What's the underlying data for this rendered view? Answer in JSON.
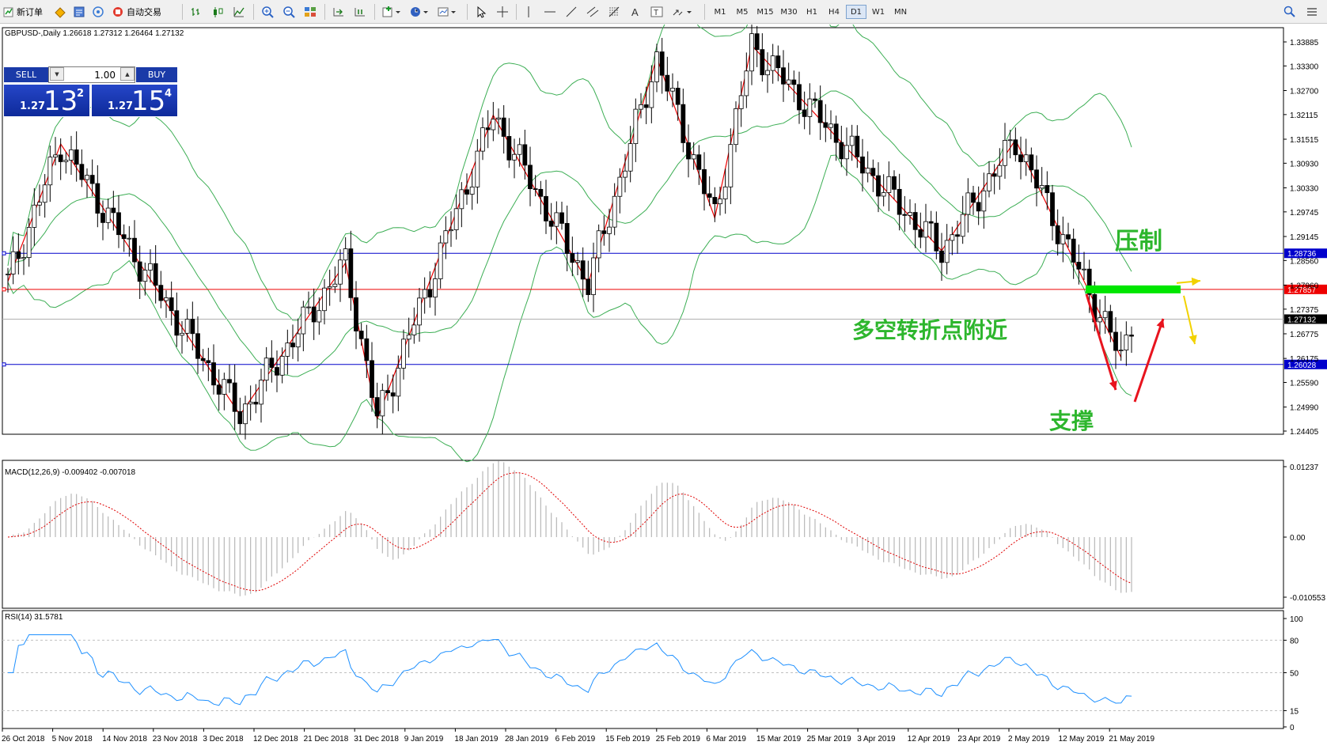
{
  "toolbar": {
    "new_order_label": "新订单",
    "autotrading_label": "自动交易",
    "timeframes": [
      "M1",
      "M5",
      "M15",
      "M30",
      "H1",
      "H4",
      "D1",
      "W1",
      "MN"
    ],
    "active_timeframe": "D1"
  },
  "trade_panel": {
    "sell_label": "SELL",
    "buy_label": "BUY",
    "lot": "1.00",
    "sell_prefix": "1.27",
    "sell_big": "13",
    "sell_sup": "2",
    "buy_prefix": "1.27",
    "buy_big": "15",
    "buy_sup": "4"
  },
  "chart": {
    "header": "GBPUSD-,Daily  1.26618 1.27312 1.26464 1.27132",
    "price_axis": [
      "1.33885",
      "1.33300",
      "1.32700",
      "1.32115",
      "1.31515",
      "1.30930",
      "1.30330",
      "1.29745",
      "1.29145",
      "1.28560",
      "1.27960",
      "1.27375",
      "1.26775",
      "1.26175",
      "1.25590",
      "1.24990",
      "1.24405"
    ],
    "price_axis_min": 1.24405,
    "price_axis_max": 1.33885,
    "date_axis": [
      "26 Oct 2018",
      "5 Nov 2018",
      "14 Nov 2018",
      "23 Nov 2018",
      "3 Dec 2018",
      "12 Dec 2018",
      "21 Dec 2018",
      "31 Dec 2018",
      "9 Jan 2019",
      "18 Jan 2019",
      "28 Jan 2019",
      "6 Feb 2019",
      "15 Feb 2019",
      "25 Feb 2019",
      "6 Mar 2019",
      "15 Mar 2019",
      "25 Mar 2019",
      "3 Apr 2019",
      "12 Apr 2019",
      "23 Apr 2019",
      "2 May 2019",
      "12 May 2019",
      "21 May 2019"
    ],
    "hlines": [
      {
        "price": 1.28736,
        "label": "1.28736",
        "color": "#0000cc"
      },
      {
        "price": 1.27857,
        "label": "1.27857",
        "color": "#ee0000"
      },
      {
        "price": 1.27132,
        "label": "1.27132",
        "color": "#000000"
      },
      {
        "price": 1.26028,
        "label": "1.26028",
        "color": "#0000cc"
      }
    ],
    "annotations": {
      "resistance": "压制",
      "pivot": "多空转折点附近",
      "support": "支撑"
    },
    "colors": {
      "annotation_text": "#2db62d",
      "zigzag": "#ee0000",
      "bands": "#3cae54",
      "pivot_bar": "#00e600",
      "arrow_red": "#e8141e",
      "arrow_yellow": "#f2d200"
    }
  },
  "macd": {
    "header": "MACD(12,26,9) -0.009402 -0.007018",
    "axis": [
      "0.01237",
      "0.00",
      "-0.010553"
    ]
  },
  "rsi": {
    "header": "RSI(14) 31.5781",
    "axis": [
      "100",
      "80",
      "50",
      "15",
      "0"
    ],
    "levels": [
      80,
      50,
      15
    ]
  }
}
